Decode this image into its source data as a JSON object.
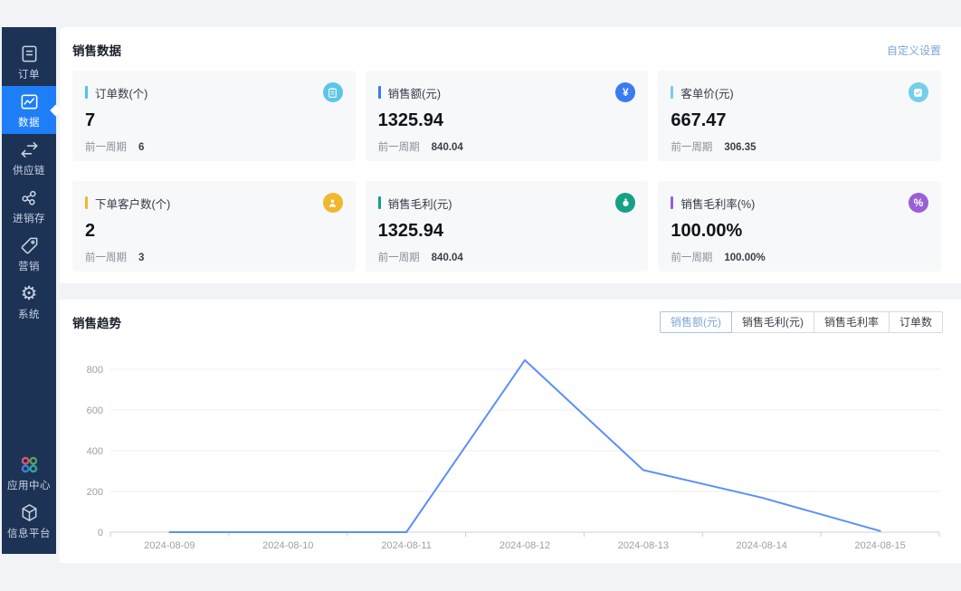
{
  "sidebar": {
    "items": [
      {
        "label": "订单",
        "icon": "document-icon",
        "active": false
      },
      {
        "label": "数据",
        "icon": "line-chart-icon",
        "active": true
      },
      {
        "label": "供应链",
        "icon": "swap-arrows-icon",
        "active": false
      },
      {
        "label": "进销存",
        "icon": "nodes-icon",
        "active": false
      },
      {
        "label": "营销",
        "icon": "tag-icon",
        "active": false
      },
      {
        "label": "系统",
        "icon": "gear-icon",
        "active": false
      }
    ],
    "bottom_items": [
      {
        "label": "应用中心",
        "icon": "apps-icon"
      },
      {
        "label": "信息平台",
        "icon": "cube-icon"
      }
    ],
    "colors": {
      "bg": "#1d3356",
      "active_bg": "#1e7ef7"
    }
  },
  "sales_data": {
    "title": "销售数据",
    "settings_link": "自定义设置",
    "prev_label": "前一周期",
    "cards": [
      {
        "label": "订单数(个)",
        "value": "7",
        "prev": "6",
        "accent": "#4fc3e8",
        "icon": "clipboard-icon",
        "icon_bg": "#5fc5e7"
      },
      {
        "label": "销售额(元)",
        "value": "1325.94",
        "prev": "840.04",
        "accent": "#3a7bf0",
        "icon": "yuan-icon",
        "icon_bg": "#3a7bf0"
      },
      {
        "label": "客单价(元)",
        "value": "667.47",
        "prev": "306.35",
        "accent": "#74cfe9",
        "icon": "badge-check-icon",
        "icon_bg": "#74cfe9"
      },
      {
        "label": "下单客户数(个)",
        "value": "2",
        "prev": "3",
        "accent": "#f3b62f",
        "icon": "user-icon",
        "icon_bg": "#f3b62f"
      },
      {
        "label": "销售毛利(元)",
        "value": "1325.94",
        "prev": "840.04",
        "accent": "#16a085",
        "icon": "moneybag-icon",
        "icon_bg": "#16a085"
      },
      {
        "label": "销售毛利率(%)",
        "value": "100.00%",
        "prev": "100.00%",
        "accent": "#9a5fd6",
        "icon": "percent-icon",
        "icon_bg": "#9a5fd6"
      }
    ]
  },
  "sales_trend": {
    "title": "销售趋势",
    "tabs": [
      {
        "label": "销售额(元)",
        "active": true
      },
      {
        "label": "销售毛利(元)",
        "active": false
      },
      {
        "label": "销售毛利率",
        "active": false
      },
      {
        "label": "订单数",
        "active": false
      }
    ]
  },
  "chart_data": {
    "type": "line",
    "title": "销售趋势",
    "x": [
      "2024-08-09",
      "2024-08-10",
      "2024-08-11",
      "2024-08-12",
      "2024-08-13",
      "2024-08-14",
      "2024-08-15"
    ],
    "series": [
      {
        "name": "销售额(元)",
        "values": [
          0,
          0,
          0,
          845,
          305,
          170,
          5.94
        ]
      }
    ],
    "xlabel": "",
    "ylabel": "",
    "ylim": [
      0,
      800
    ],
    "yticks": [
      0,
      200,
      400,
      600,
      800
    ],
    "grid": true,
    "legend_position": "none",
    "line_color": "#5b8ff9",
    "grid_color": "#ececec",
    "axis_color": "#cfcfcf"
  }
}
